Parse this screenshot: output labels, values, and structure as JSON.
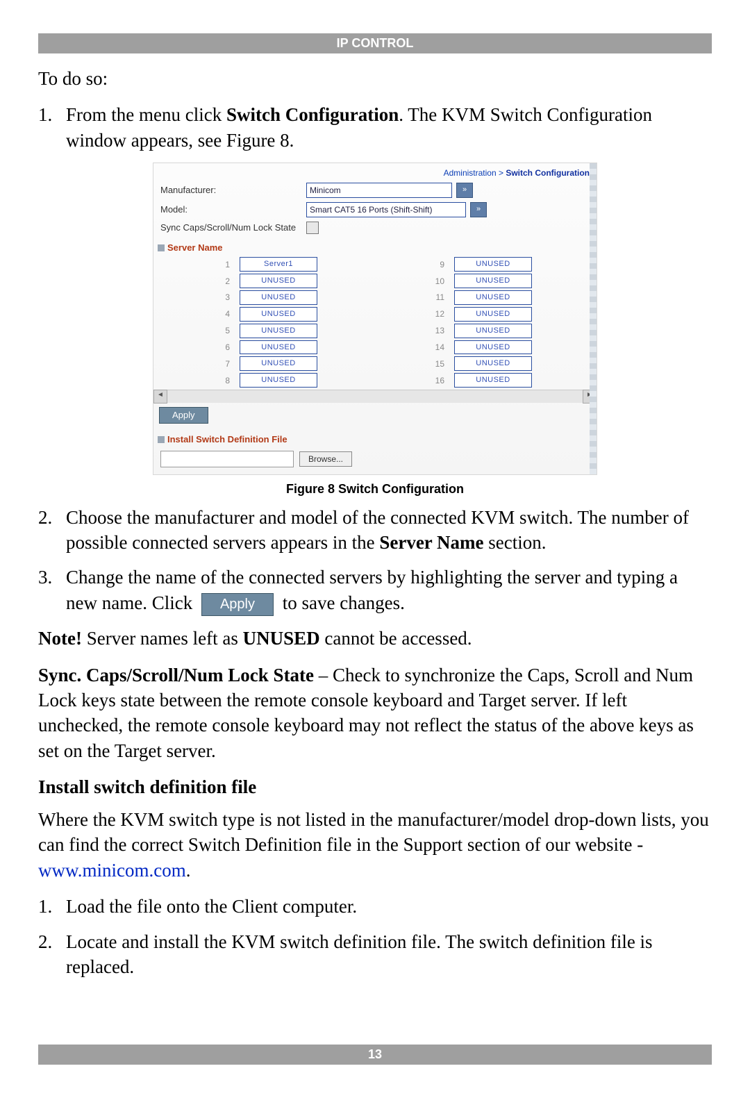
{
  "header": "IP CONTROL",
  "footer": "13",
  "intro": "To do so:",
  "steps_a": {
    "n1": "1.",
    "t1a": "From the menu click ",
    "t1b": "Switch Configuration",
    "t1c": ". The KVM Switch Configuration window appears, see Figure 8.",
    "n2": "2.",
    "t2a": "Choose the manufacturer and model of the connected KVM switch. The number of possible connected servers appears in the ",
    "t2b": "Server Name",
    "t2c": " section.",
    "n3": "3.",
    "t3a": "Change the name of the connected servers by highlighting the server and typing a new name. Click ",
    "apply_label": "Apply",
    "t3b": " to save changes."
  },
  "note": {
    "a": "Note!",
    "b": " Server names left as ",
    "c": "UNUSED",
    "d": " cannot be accessed."
  },
  "sync": {
    "a": "Sync. Caps/Scroll/Num Lock State",
    "b": " – Check to synchronize the Caps, Scroll and Num Lock keys state between the remote console keyboard and Target server. If left unchecked, the remote console keyboard may not reflect the status of the above keys as set on the Target server."
  },
  "subhead": "Install switch definition file",
  "para2a": "Where the KVM switch type is not listed in the manufacturer/model drop-down lists, you can find the correct Switch Definition file in the Support section of our website - ",
  "para2link": "www.minicom.com",
  "para2b": ".",
  "steps_b": {
    "n1": "1.",
    "t1": "Load the file onto the Client computer.",
    "n2": "2.",
    "t2": "Locate and install the KVM switch definition file. The switch definition file is replaced."
  },
  "figure": {
    "caption": "Figure 8 Switch Configuration",
    "breadcrumb": {
      "a": "Administration > ",
      "b": "Switch Configuration"
    },
    "manufacturer_label": "Manufacturer:",
    "manufacturer_value": "Minicom",
    "model_label": "Model:",
    "model_value": "Smart CAT5 16 Ports (Shift-Shift)",
    "sync_label": "Sync Caps/Scroll/Num Lock State",
    "dropdown_glyph": "»",
    "server_name_header": "Server Name",
    "apply": "Apply",
    "install_header": "Install Switch Definition File",
    "browse": "Browse...",
    "servers_left": [
      {
        "idx": "1",
        "name": "Server1"
      },
      {
        "idx": "2",
        "name": "UNUSED"
      },
      {
        "idx": "3",
        "name": "UNUSED"
      },
      {
        "idx": "4",
        "name": "UNUSED"
      },
      {
        "idx": "5",
        "name": "UNUSED"
      },
      {
        "idx": "6",
        "name": "UNUSED"
      },
      {
        "idx": "7",
        "name": "UNUSED"
      },
      {
        "idx": "8",
        "name": "UNUSED"
      }
    ],
    "servers_right": [
      {
        "idx": "9",
        "name": "UNUSED"
      },
      {
        "idx": "10",
        "name": "UNUSED"
      },
      {
        "idx": "11",
        "name": "UNUSED"
      },
      {
        "idx": "12",
        "name": "UNUSED"
      },
      {
        "idx": "13",
        "name": "UNUSED"
      },
      {
        "idx": "14",
        "name": "UNUSED"
      },
      {
        "idx": "15",
        "name": "UNUSED"
      },
      {
        "idx": "16",
        "name": "UNUSED"
      }
    ],
    "scroll_left": "◄",
    "scroll_right": "►"
  }
}
